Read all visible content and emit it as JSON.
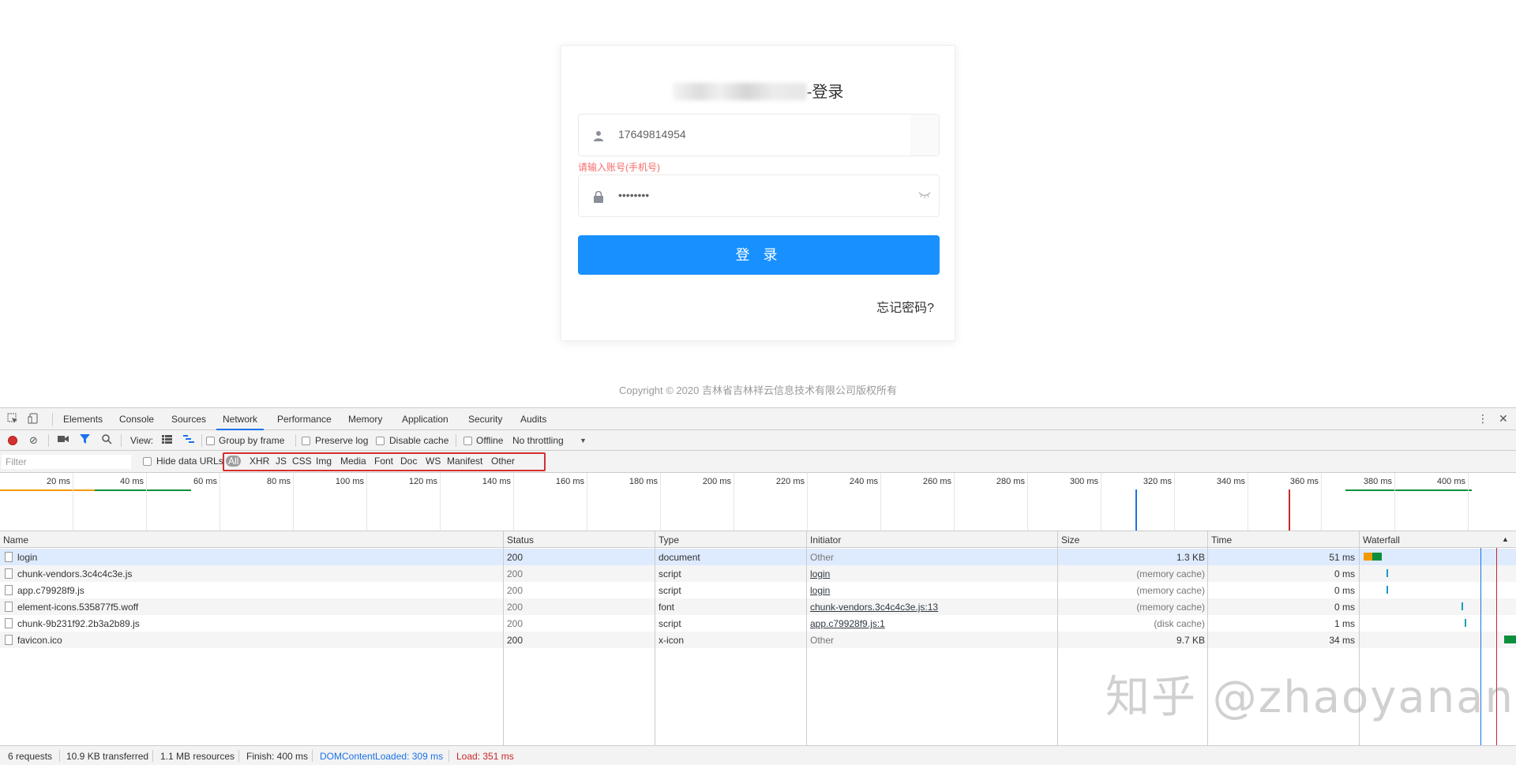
{
  "login_page": {
    "title_suffix": "-登录",
    "account_value": "17649814954",
    "account_error": "请输入账号(手机号)",
    "password_value": "••••••••",
    "login_button": "登 录",
    "forgot_password": "忘记密码?",
    "copyright": "Copyright © 2020 吉林省吉林祥云信息技术有限公司版权所有"
  },
  "devtools": {
    "tabs": [
      "Elements",
      "Console",
      "Sources",
      "Network",
      "Performance",
      "Memory",
      "Application",
      "Security",
      "Audits"
    ],
    "active_tab": "Network",
    "toolbar": {
      "view_label": "View:",
      "group_by_frame": "Group by frame",
      "preserve_log": "Preserve log",
      "disable_cache": "Disable cache",
      "offline": "Offline",
      "throttling": "No throttling"
    },
    "filter": {
      "placeholder": "Filter",
      "hide_data_urls": "Hide data URLs",
      "types": [
        "All",
        "XHR",
        "JS",
        "CSS",
        "Img",
        "Media",
        "Font",
        "Doc",
        "WS",
        "Manifest",
        "Other"
      ],
      "active_type": "All"
    },
    "overview_ticks": [
      "20 ms",
      "40 ms",
      "60 ms",
      "80 ms",
      "100 ms",
      "120 ms",
      "140 ms",
      "160 ms",
      "180 ms",
      "200 ms",
      "220 ms",
      "240 ms",
      "260 ms",
      "280 ms",
      "300 ms",
      "320 ms",
      "340 ms",
      "360 ms",
      "380 ms",
      "400 ms",
      "4…"
    ],
    "columns": [
      "Name",
      "Status",
      "Type",
      "Initiator",
      "Size",
      "Time",
      "Waterfall"
    ],
    "rows": [
      {
        "name": "login",
        "status": "200",
        "type": "document",
        "initiator": "Other",
        "size": "1.3 KB",
        "time": "51 ms"
      },
      {
        "name": "chunk-vendors.3c4c4c3e.js",
        "status": "200",
        "type": "script",
        "initiator": "login",
        "size": "(memory cache)",
        "time": "0 ms"
      },
      {
        "name": "app.c79928f9.js",
        "status": "200",
        "type": "script",
        "initiator": "login",
        "size": "(memory cache)",
        "time": "0 ms"
      },
      {
        "name": "element-icons.535877f5.woff",
        "status": "200",
        "type": "font",
        "initiator": "chunk-vendors.3c4c4c3e.js:13",
        "size": "(memory cache)",
        "time": "0 ms"
      },
      {
        "name": "chunk-9b231f92.2b3a2b89.js",
        "status": "200",
        "type": "script",
        "initiator": "app.c79928f9.js:1",
        "size": "(disk cache)",
        "time": "1 ms"
      },
      {
        "name": "favicon.ico",
        "status": "200",
        "type": "x-icon",
        "initiator": "Other",
        "size": "9.7 KB",
        "time": "34 ms"
      }
    ],
    "status_bar": {
      "requests": "6 requests",
      "transferred": "10.9 KB transferred",
      "resources": "1.1 MB resources",
      "finish": "Finish: 400 ms",
      "dom_content_loaded": "DOMContentLoaded: 309 ms",
      "load": "Load: 351 ms"
    },
    "colors": {
      "accent": "#1a73e8",
      "dcl": "#1a73e8",
      "load": "#c62828"
    }
  },
  "watermark": "知乎 @zhaoyanan"
}
